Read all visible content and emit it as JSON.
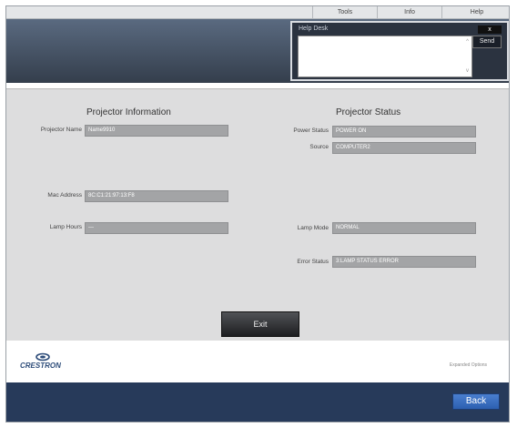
{
  "topnav": {
    "items": [
      "Tools",
      "Info",
      "Help"
    ]
  },
  "help_desk": {
    "title": "Help Desk",
    "close_label": "x",
    "send_label": "Send",
    "scroll_up": "^",
    "scroll_down": "v"
  },
  "projector_info": {
    "title": "Projector Information",
    "name_label": "Projector Name",
    "name_value": "Name9910",
    "mac_label": "Mac Address",
    "mac_value": "8C:C1:21:97:13:F8",
    "lamp_hours_label": "Lamp Hours",
    "lamp_hours_value": "---"
  },
  "projector_status": {
    "title": "Projector Status",
    "power_label": "Power Status",
    "power_value": "POWER ON",
    "source_label": "Source",
    "source_value": "COMPUTER2",
    "lamp_mode_label": "Lamp Mode",
    "lamp_mode_value": "NORMAL",
    "error_label": "Error Status",
    "error_value": "3:LAMP STATUS ERROR"
  },
  "exit_label": "Exit",
  "footer": {
    "brand": "CRESTRON",
    "tagline": "Expanded Options"
  },
  "back_label": "Back",
  "colors": {
    "header": "#343e4c",
    "panel": "#ddddde",
    "field": "#a3a4a6",
    "bottom_bar": "#273a5a",
    "back_button": "#3a6fc0"
  }
}
